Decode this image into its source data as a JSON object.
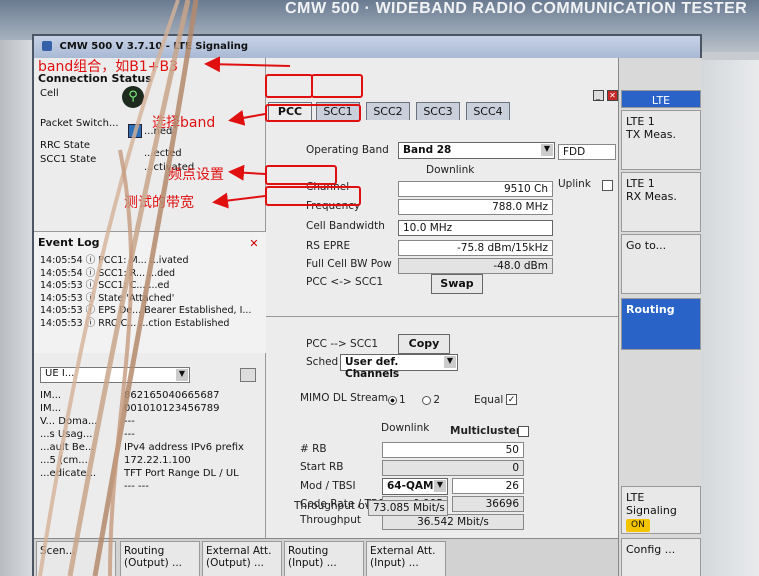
{
  "instrument": {
    "brand_left": "...",
    "brand": "CMW 500 · WIDEBAND RADIO COMMUNICATION TESTER"
  },
  "window": {
    "title": "CMW 500 V 3.7.10 - LTE Signaling"
  },
  "connection_status": {
    "heading": "Connection Status",
    "rows": [
      {
        "label": "Cell",
        "value": ""
      },
      {
        "label": "Packet Switch...",
        "value": "...ned"
      },
      {
        "label": "RRC State",
        "value": "...ected"
      },
      {
        "label": "SCC1 State",
        "value": "...ctivated"
      }
    ]
  },
  "event_log": {
    "heading": "Event Log",
    "items": [
      "14:05:54 ⓘ PCC1: M... ...ivated",
      "14:05:54 ⓘ SCC1: R... ...ded",
      "14:05:53 ⓘ SCC1: C... ...ed",
      "14:05:53 ⓘ State 'Attached'",
      "14:05:53 ⓘ EPS De... Bearer Established, I...",
      "14:05:53 ⓘ RRC C... ...ction Established"
    ]
  },
  "ue_info": {
    "select_value": "UE I...",
    "rows": [
      {
        "k": "IM...",
        "v": "862165040665687"
      },
      {
        "k": "IM...",
        "v": "001010123456789"
      },
      {
        "k": "V... Doma...",
        "v": "---"
      },
      {
        "k": "...s Usag...",
        "v": "---"
      },
      {
        "k": "...ault Be...",
        "v": "IPv4 address   IPv6 prefix"
      },
      {
        "k": "...5 (cm...",
        "v": "172.22.1.100"
      },
      {
        "k": "...edicate...",
        "v": "TFT Port Range DL / UL"
      },
      {
        "k": "",
        "v": "---         ---"
      }
    ]
  },
  "tabs": [
    "PCC",
    "SCC1",
    "SCC2",
    "SCC3",
    "SCC4"
  ],
  "active_tab": "SCC1",
  "config": {
    "operating_band_label": "Operating Band",
    "operating_band_value": "Band 28",
    "duplex_value": "FDD",
    "downlink_label": "Downlink",
    "uplink_label": "Uplink",
    "channel_label": "Channel",
    "channel_value": "9510  Ch",
    "frequency_label": "Frequency",
    "frequency_value": "788.0  MHz",
    "cell_bw_label": "Cell Bandwidth",
    "cell_bw_value": "10.0 MHz",
    "rs_epre_label": "RS EPRE",
    "rs_epre_value": "-75.8  dBm/15kHz",
    "full_cell_label": "Full Cell BW Pow",
    "full_cell_value": "-48.0  dBm",
    "pcc_scc_label": "PCC <-> SCC1",
    "swap_label": "Swap",
    "pcc_copy_label": "PCC --> SCC1",
    "copy_label": "Copy",
    "sched_label": "Sched",
    "sched_value": "User def. Channels",
    "mimo_label": "MIMO DL Stream",
    "mimo_opt1": "1",
    "mimo_opt2": "2",
    "equal_label": "Equal",
    "downlink2_label": "Downlink",
    "multicluster_label": "Multicluster",
    "rb_label": "# RB",
    "rb_value": "50",
    "start_rb_label": "Start RB",
    "start_rb_value": "0",
    "mod_label": "Mod / TBSI",
    "mod_value": "64-QAM",
    "tbsi_value": "26",
    "code_rate_label": "Code Rate / TBS",
    "code_rate_value": "0.905",
    "tbs_value": "36696",
    "throughput_label": "Throughput",
    "throughput_value": "36.542  Mbit/s",
    "throughput_overall_label": "Throughput overall",
    "throughput_overall_value": "73.085  Mbit/s"
  },
  "softkeys": {
    "header": "LTE",
    "items": [
      "LTE 1\nTX Meas.",
      "LTE 1\nRX Meas.",
      "Go to...",
      "Routing",
      "LTE\nSignaling",
      "Config ..."
    ],
    "on_badge": "ON"
  },
  "bottom_keys": [
    "Scen...",
    "Routing\n(Output) ...",
    "External Att.\n(Output) ...",
    "Routing\n(Input) ...",
    "External Att.\n(Input) ..."
  ],
  "annotations": {
    "band_combo": "band组合，如B1+B3",
    "select_band": "选择band",
    "freq_setting": "频点设置",
    "test_bw": "测试的带宽"
  }
}
